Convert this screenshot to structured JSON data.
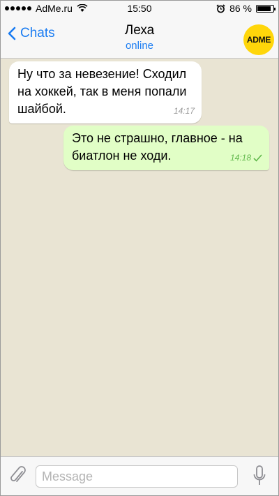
{
  "status": {
    "carrier": "AdMe.ru",
    "time": "15:50",
    "battery": "86 %",
    "battery_level": 0.86
  },
  "header": {
    "back_label": "Chats",
    "contact_name": "Леха",
    "contact_status": "online",
    "avatar_text": "ADME"
  },
  "messages": [
    {
      "direction": "incoming",
      "text": "Ну что за невезение! Сходил на хоккей, так в меня попали шайбой.",
      "time": "14:17"
    },
    {
      "direction": "outgoing",
      "text": "Это не страшно, главное - на биатлон не ходи.",
      "time": "14:18",
      "read": true
    }
  ],
  "composer": {
    "placeholder": "Message"
  },
  "colors": {
    "accent": "#1a7cf2",
    "outgoing_bubble": "#e1fec6",
    "incoming_bubble": "#ffffff",
    "chat_bg": "#e9e4d3",
    "avatar": "#ffd60a"
  },
  "icons": [
    "signal-dots-icon",
    "wifi-icon",
    "alarm-icon",
    "battery-icon",
    "back-chevron-icon",
    "paperclip-icon",
    "microphone-icon",
    "read-check-icon"
  ]
}
